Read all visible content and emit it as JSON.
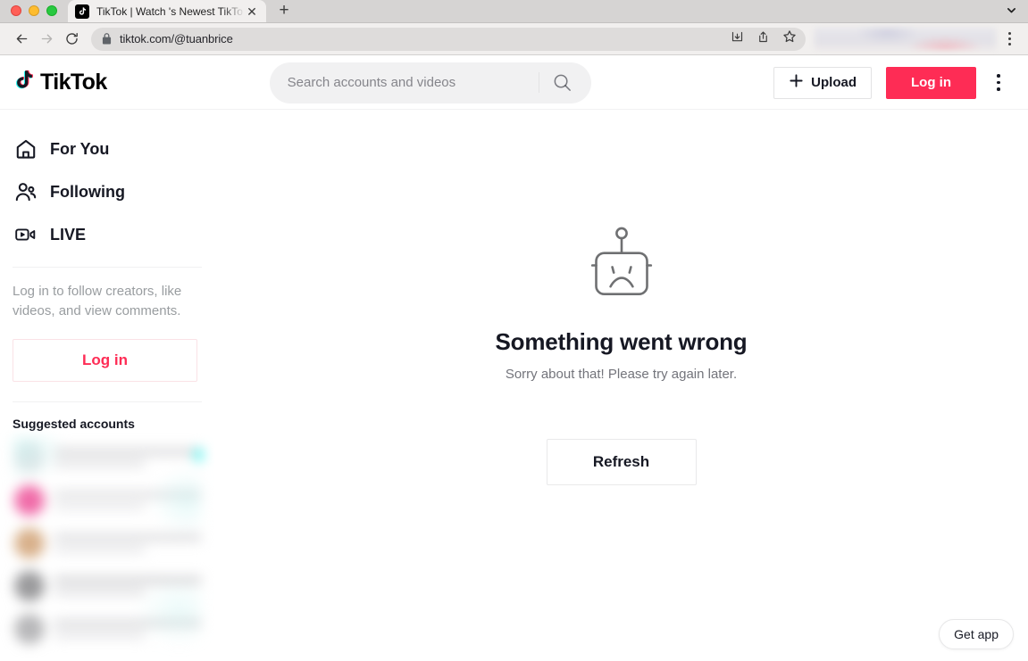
{
  "browser": {
    "tab": {
      "title": "TikTok | Watch 's Newest TikTo",
      "favicon_icon": "tiktok-note-icon",
      "close_icon": "close-icon"
    },
    "new_tab_icon": "plus-icon",
    "tab_list_icon": "chevron-down-icon",
    "back_icon": "arrow-left-icon",
    "forward_icon": "arrow-right-icon",
    "reload_icon": "reload-icon",
    "lock_icon": "lock-icon",
    "url": "tiktok.com/@tuanbrice",
    "omnibox_actions": [
      "install-icon",
      "share-icon",
      "bookmark-star-icon"
    ],
    "menu_icon": "kebab-menu-icon",
    "traffic_lights": [
      "close-red",
      "minimize-yellow",
      "maximize-green"
    ]
  },
  "header": {
    "logo_text": "TikTok",
    "logo_icon": "tiktok-note-icon",
    "search": {
      "placeholder": "Search accounts and videos",
      "value": "",
      "icon": "search-icon"
    },
    "upload_label": "Upload",
    "upload_icon": "plus-icon",
    "login_label": "Log in",
    "menu_icon": "kebab-menu-icon"
  },
  "sidebar": {
    "nav": [
      {
        "label": "For You",
        "icon": "home-icon"
      },
      {
        "label": "Following",
        "icon": "users-icon"
      },
      {
        "label": "LIVE",
        "icon": "live-video-icon"
      }
    ],
    "login_prompt": "Log in to follow creators, like videos, and view comments.",
    "login_label": "Log in",
    "suggested_title": "Suggested accounts",
    "suggested_accounts_blurred": [
      {
        "avatar_color": "#e6e6e8",
        "line_color": "#dcdcde"
      },
      {
        "avatar_color": "#f06ba8",
        "line_color": "#e2e2e4"
      },
      {
        "avatar_color": "#d8b08a",
        "line_color": "#dedee0"
      },
      {
        "avatar_color": "#9a9a9c",
        "line_color": "#d6d6d8"
      },
      {
        "avatar_color": "#b8b8ba",
        "line_color": "#dcdcde"
      }
    ]
  },
  "main": {
    "robot_icon": "sad-robot-icon",
    "error_title": "Something went wrong",
    "error_subtitle": "Sorry about that! Please try again later.",
    "refresh_label": "Refresh"
  },
  "footer": {
    "get_app_label": "Get app"
  },
  "colors": {
    "brand_red": "#fe2c55",
    "brand_cyan": "#25f4ee",
    "text_primary": "#161823",
    "text_muted": "#999da0"
  }
}
